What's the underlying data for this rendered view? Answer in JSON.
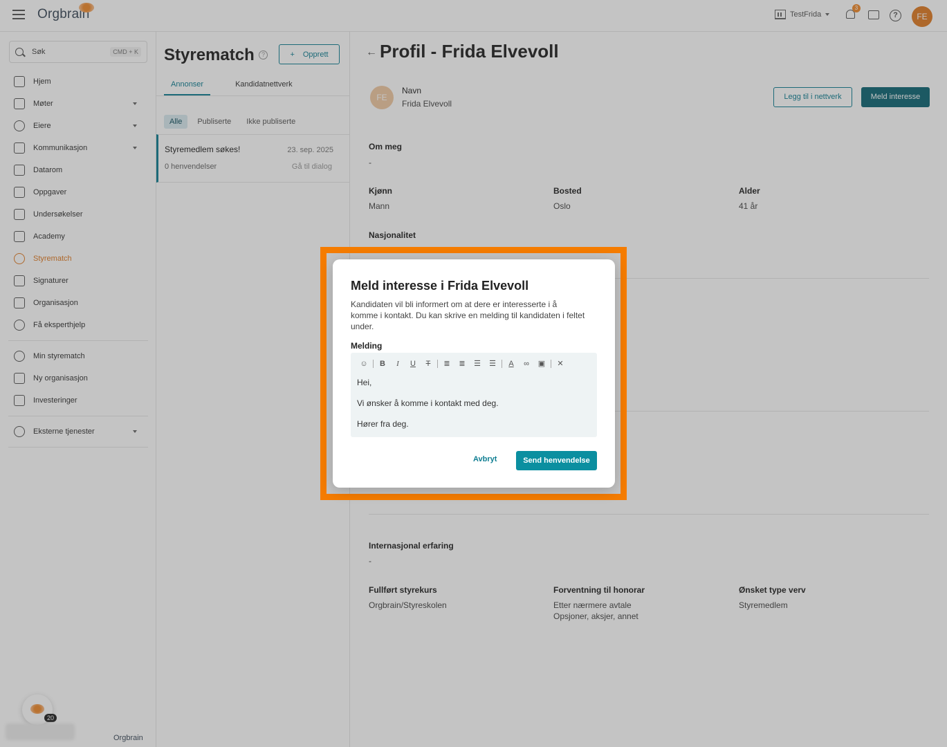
{
  "topbar": {
    "logo": "Orgbrain",
    "org_name": "TestFrida",
    "notification_count": "3",
    "avatar_initials": "FE"
  },
  "sidebar": {
    "search_placeholder": "Søk",
    "search_shortcut": "CMD + K",
    "items": [
      {
        "label": "Hjem",
        "icon": "home-icon"
      },
      {
        "label": "Møter",
        "icon": "gavel-icon",
        "expandable": true
      },
      {
        "label": "Eiere",
        "icon": "people-icon",
        "expandable": true
      },
      {
        "label": "Kommunikasjon",
        "icon": "message-icon",
        "expandable": true
      },
      {
        "label": "Datarom",
        "icon": "folder-icon"
      },
      {
        "label": "Oppgaver",
        "icon": "task-icon"
      },
      {
        "label": "Undersøkelser",
        "icon": "survey-icon"
      },
      {
        "label": "Academy",
        "icon": "graduation-cap-icon"
      },
      {
        "label": "Styrematch",
        "icon": "styrematch-icon",
        "active": true
      },
      {
        "label": "Signaturer",
        "icon": "pen-icon"
      },
      {
        "label": "Organisasjon",
        "icon": "building-icon"
      },
      {
        "label": "Få eksperthjelp",
        "icon": "expert-help-icon"
      }
    ],
    "items2": [
      {
        "label": "Min styrematch",
        "icon": "styrematch-icon"
      },
      {
        "label": "Ny organisasjon",
        "icon": "building-add-icon"
      },
      {
        "label": "Investeringer",
        "icon": "chart-icon"
      }
    ],
    "items3": [
      {
        "label": "Eksterne tjenester",
        "icon": "services-icon",
        "expandable": true
      }
    ],
    "float_count": "20",
    "bottom_logo": "Orgbrain"
  },
  "middle": {
    "title": "Styrematch",
    "create_label": "Opprett",
    "tabs": [
      "Annonser",
      "Kandidatnettverk"
    ],
    "filters": [
      "Alle",
      "Publiserte",
      "Ikke publiserte"
    ],
    "ad": {
      "title": "Styremedlem søkes!",
      "date": "23. sep. 2025",
      "inquiries": "0 henvendelser",
      "link": "Gå til dialog"
    }
  },
  "profile": {
    "title": "Profil - Frida Elvevoll",
    "avatar": "FE",
    "name_label": "Navn",
    "name": "Frida Elvevoll",
    "add_network_label": "Legg til i nettverk",
    "interest_label": "Meld interesse",
    "about_label": "Om meg",
    "about_value": "-",
    "gender_label": "Kjønn",
    "gender_value": "Mann",
    "location_label": "Bosted",
    "location_value": "Oslo",
    "age_label": "Alder",
    "age_value": "41 år",
    "nationality_label": "Nasjonalitet",
    "intl_label": "Internasjonal erfaring",
    "intl_value": "-",
    "course_label": "Fullført styrekurs",
    "course_value": "Orgbrain/Styreskolen",
    "fee_label": "Forventning til honorar",
    "fee_value1": "Etter nærmere avtale",
    "fee_value2": "Opsjoner, aksjer, annet",
    "role_label": "Ønsket type verv",
    "role_value": "Styremedlem"
  },
  "modal": {
    "title": "Meld interesse i Frida Elvevoll",
    "description": "Kandidaten vil bli informert om at dere er interesserte i å komme i kontakt. Du kan skrive en melding til kandidaten i feltet under.",
    "message_label": "Melding",
    "message_lines": [
      "Hei,",
      "Vi ønsker å komme i kontakt med deg.",
      "Hører fra deg."
    ],
    "cancel_label": "Avbryt",
    "send_label": "Send henvendelse"
  },
  "colors": {
    "accent": "#0f7e92",
    "brand_orange": "#e07b24",
    "highlight": "#f57c00"
  }
}
